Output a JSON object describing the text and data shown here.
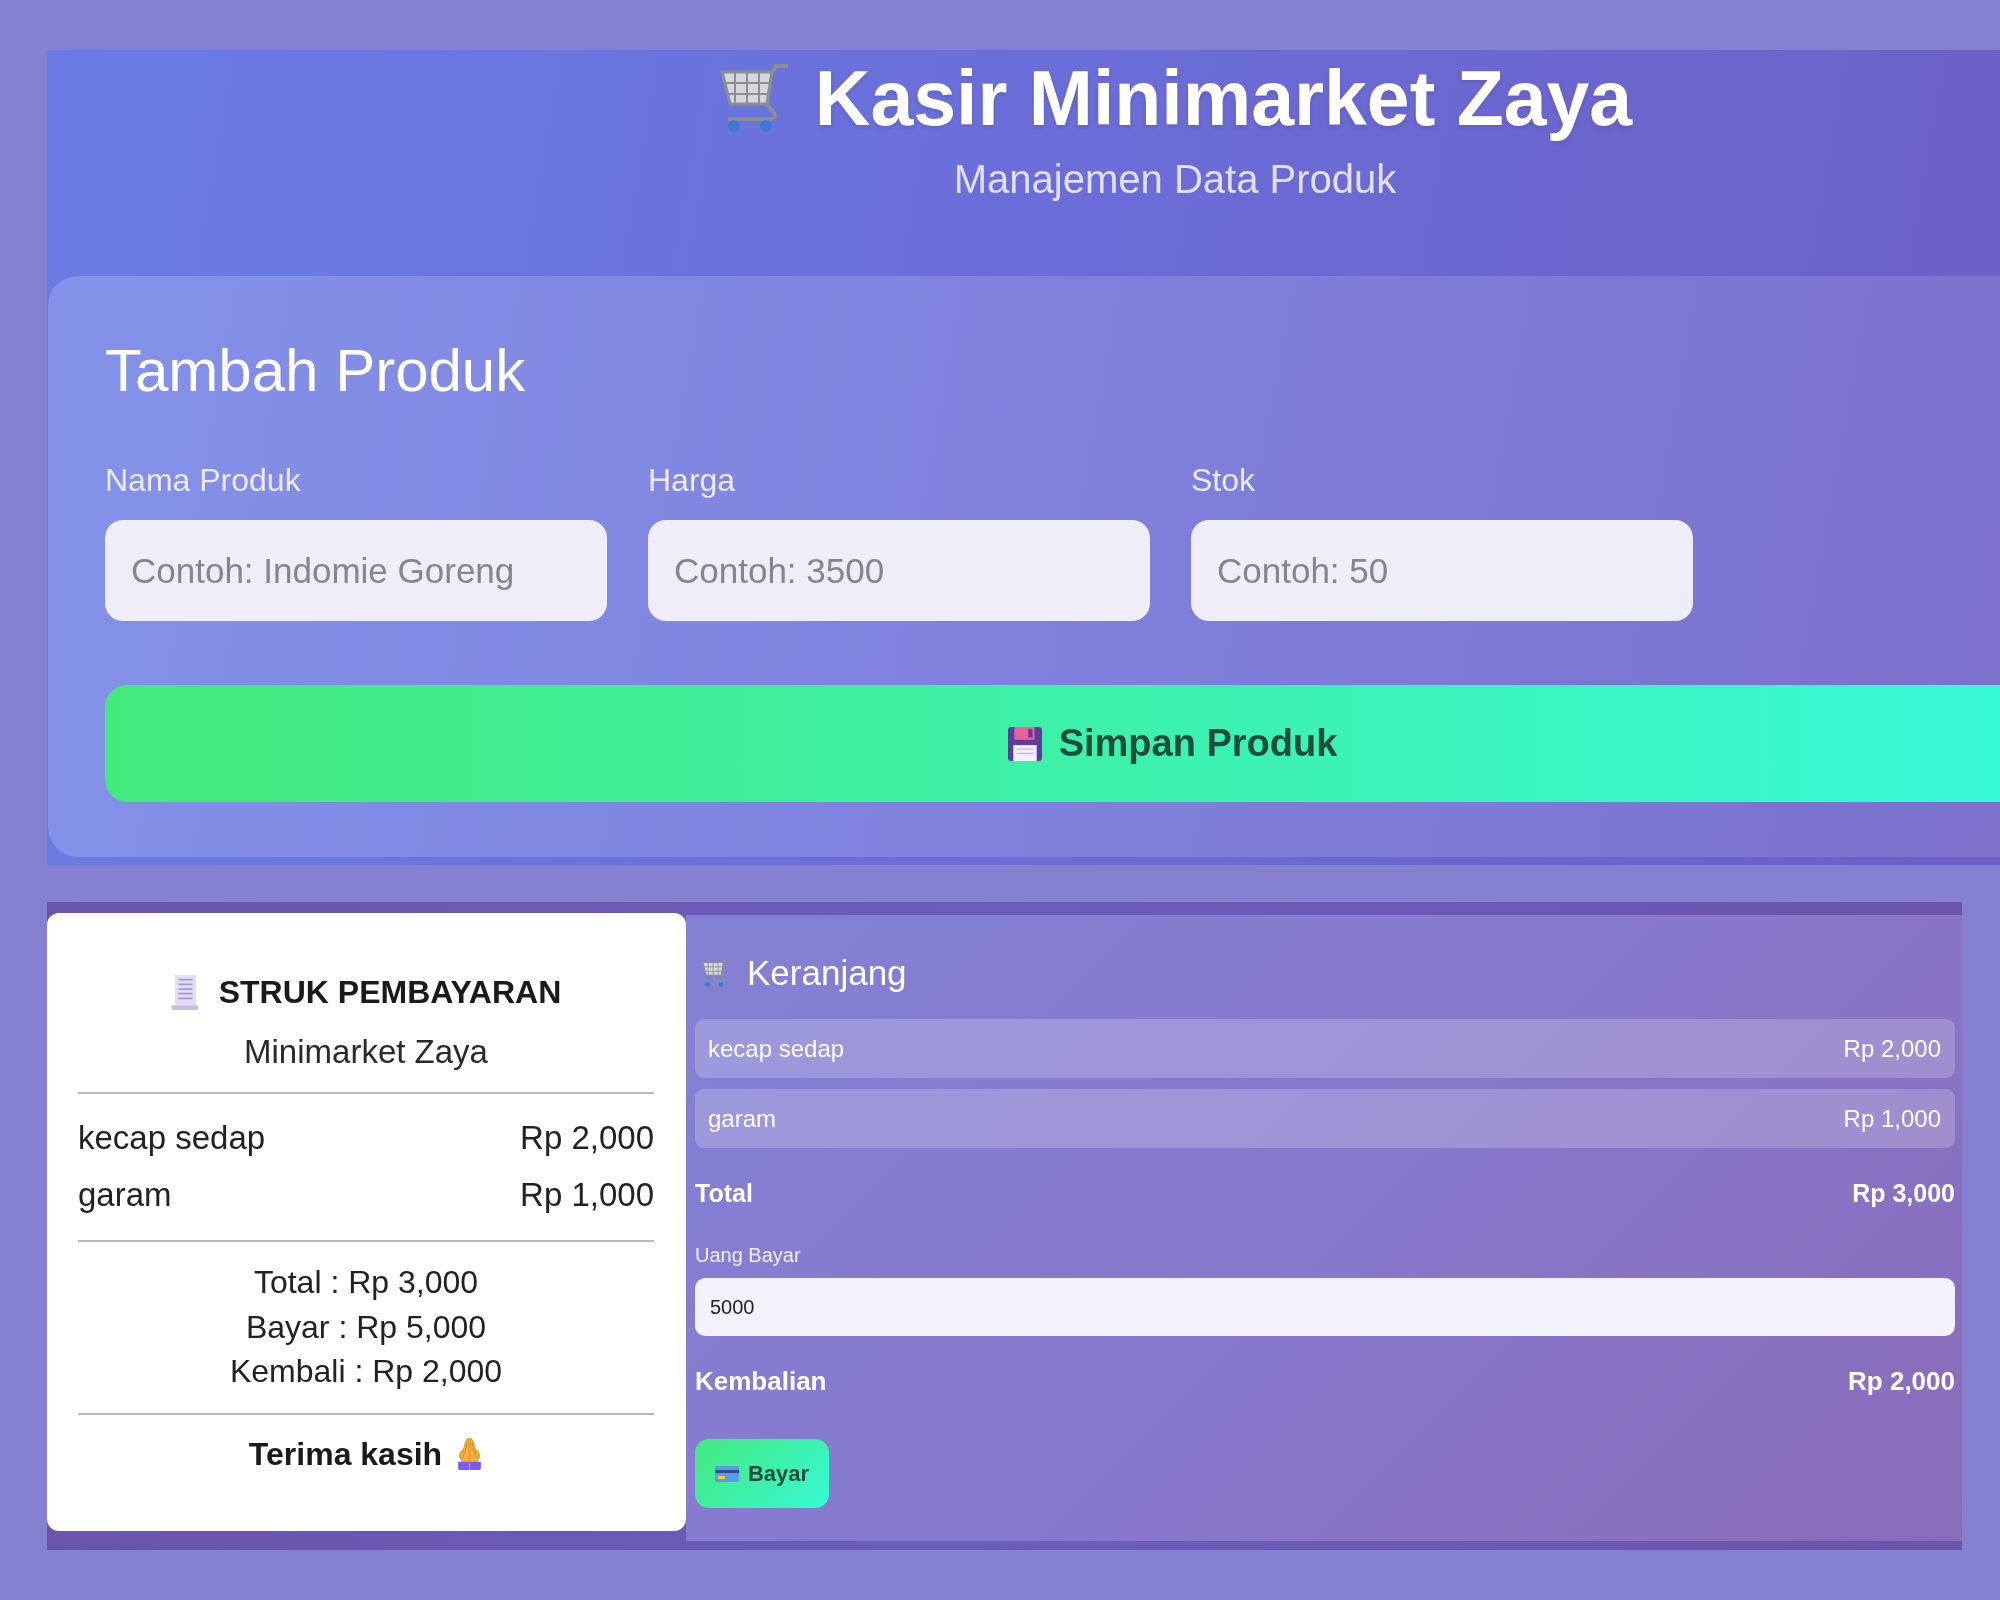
{
  "header": {
    "title": "Kasir Minimarket Zaya",
    "subtitle": "Manajemen Data Produk"
  },
  "product_form": {
    "title": "Tambah Produk",
    "fields": [
      {
        "label": "Nama Produk",
        "placeholder": "Contoh: Indomie Goreng"
      },
      {
        "label": "Harga",
        "placeholder": "Contoh: 3500"
      },
      {
        "label": "Stok",
        "placeholder": "Contoh: 50"
      }
    ],
    "submit_button": "Simpan Produk"
  },
  "receipt": {
    "title": "STRUK PEMBAYARAN",
    "store": "Minimarket Zaya",
    "items": [
      {
        "name": "kecap sedap",
        "price": "Rp 2,000"
      },
      {
        "name": "garam",
        "price": "Rp 1,000"
      }
    ],
    "summary": [
      "Total : Rp 3,000",
      "Bayar : Rp 5,000",
      "Kembali : Rp 2,000"
    ],
    "footer": "Terima kasih"
  },
  "cart": {
    "title": "Keranjang",
    "items": [
      {
        "name": "kecap sedap",
        "price": "Rp 2,000"
      },
      {
        "name": "garam",
        "price": "Rp 1,000"
      }
    ],
    "total": {
      "label": "Total",
      "value": "Rp 3,000"
    },
    "payment": {
      "label": "Uang Bayar",
      "value": "5000"
    },
    "change": {
      "label": "Kembalian",
      "value": "Rp 2,000"
    },
    "pay_button": "Bayar"
  }
}
